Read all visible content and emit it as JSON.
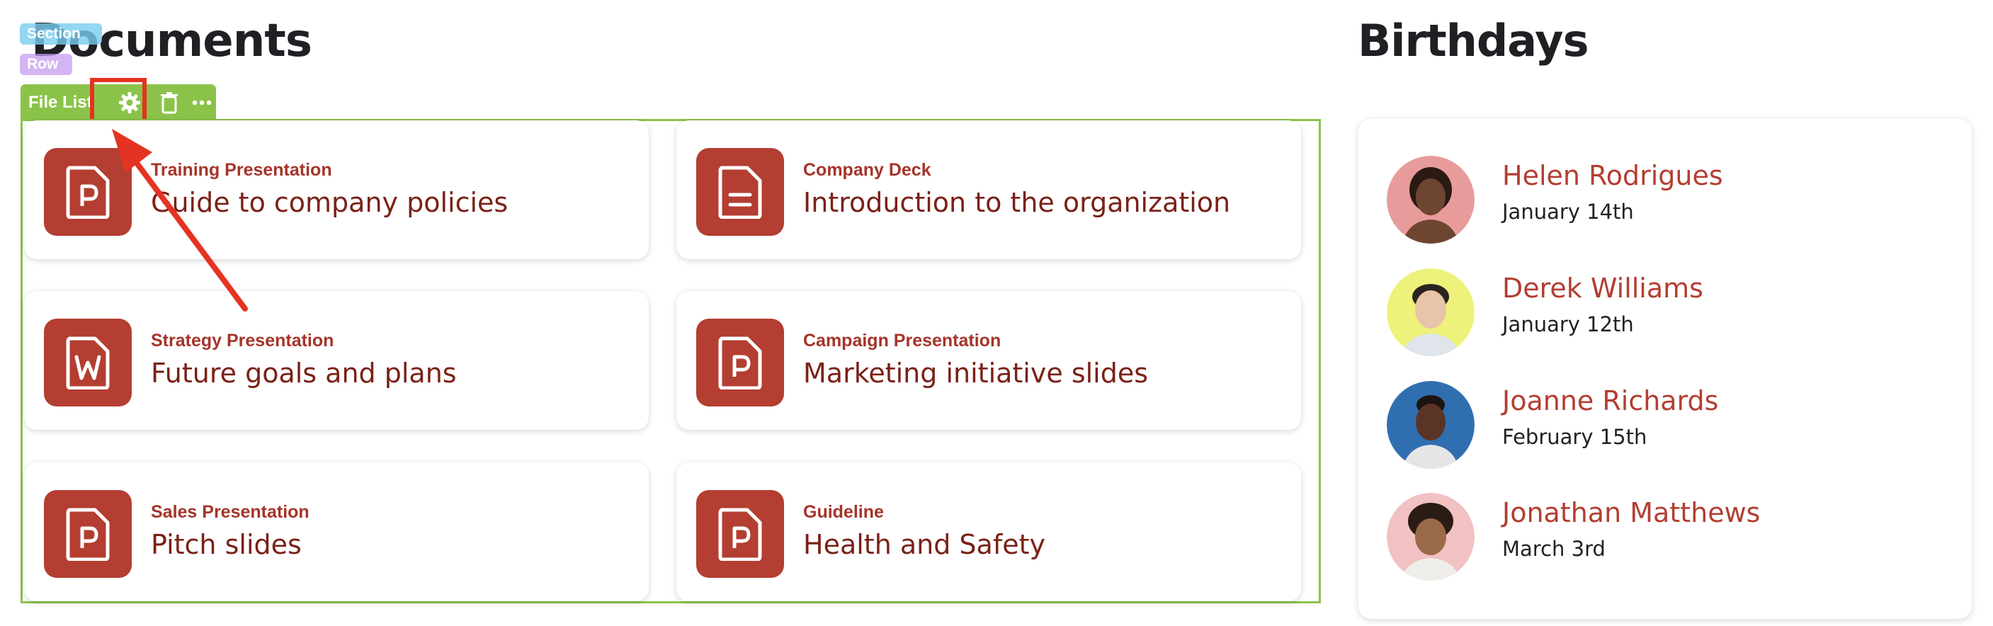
{
  "builder": {
    "section_tag": "Section",
    "row_tag": "Row",
    "module_label": "File List",
    "highlight_color": "#e53322",
    "module_color": "#8bc34a"
  },
  "documents": {
    "title": "Documents",
    "accent": "#b33e31",
    "files": [
      {
        "type": "Training Presentation",
        "title": "Guide to company policies",
        "icon": "powerpoint-icon"
      },
      {
        "type": "Company Deck",
        "title": "Introduction to the organization",
        "icon": "document-icon"
      },
      {
        "type": "Strategy Presentation",
        "title": "Future goals and plans",
        "icon": "word-icon"
      },
      {
        "type": "Campaign Presentation",
        "title": "Marketing initiative slides",
        "icon": "powerpoint-icon"
      },
      {
        "type": "Sales Presentation",
        "title": "Pitch slides",
        "icon": "powerpoint-icon"
      },
      {
        "type": "Guideline",
        "title": "Health and Safety",
        "icon": "powerpoint-icon"
      }
    ]
  },
  "birthdays": {
    "title": "Birthdays",
    "people": [
      {
        "name": "Helen Rodrigues",
        "date": "January 14th",
        "avatar_bg": "#e89b9b"
      },
      {
        "name": "Derek Williams",
        "date": "January 12th",
        "avatar_bg": "#eef27a"
      },
      {
        "name": "Joanne Richards",
        "date": "February 15th",
        "avatar_bg": "#2f6fb0"
      },
      {
        "name": "Jonathan Matthews",
        "date": "March 3rd",
        "avatar_bg": "#f2c1c1"
      }
    ]
  }
}
